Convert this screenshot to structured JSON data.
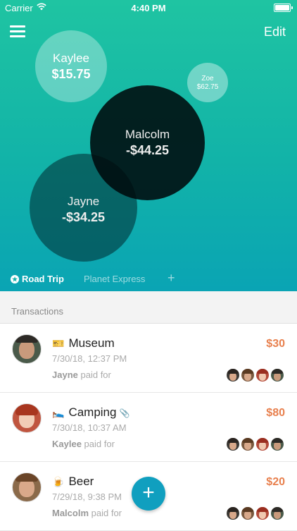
{
  "status": {
    "carrier": "Carrier",
    "time": "4:40 PM"
  },
  "header": {
    "edit_label": "Edit"
  },
  "balances": [
    {
      "name": "Kaylee",
      "amount": "$15.75"
    },
    {
      "name": "Zoe",
      "amount": "$62.75"
    },
    {
      "name": "Malcolm",
      "amount": "-$44.25"
    },
    {
      "name": "Jayne",
      "amount": "-$34.25"
    }
  ],
  "tabs": [
    {
      "label": "Road Trip",
      "active": true
    },
    {
      "label": "Planet Express",
      "active": false
    }
  ],
  "add_tab_label": "+",
  "section_title": "Transactions",
  "paid_for_text": "paid for",
  "transactions": [
    {
      "emoji": "🎫",
      "title": "Museum",
      "date": "7/30/18, 12:37 PM",
      "payer": "Jayne",
      "amount": "$30",
      "has_attachment": false
    },
    {
      "emoji": "🛌",
      "title": "Camping",
      "date": "7/30/18, 10:37 AM",
      "payer": "Kaylee",
      "amount": "$80",
      "has_attachment": true
    },
    {
      "emoji": "🍺",
      "title": "Beer",
      "date": "7/29/18, 9:38 PM",
      "payer": "Malcolm",
      "amount": "$20",
      "has_attachment": false
    }
  ],
  "fab_label": "+",
  "colors": {
    "accent": "#e8804e",
    "fab": "#109fbf",
    "gradient_top": "#1fc4a2",
    "gradient_bottom": "#0aa4b4"
  }
}
